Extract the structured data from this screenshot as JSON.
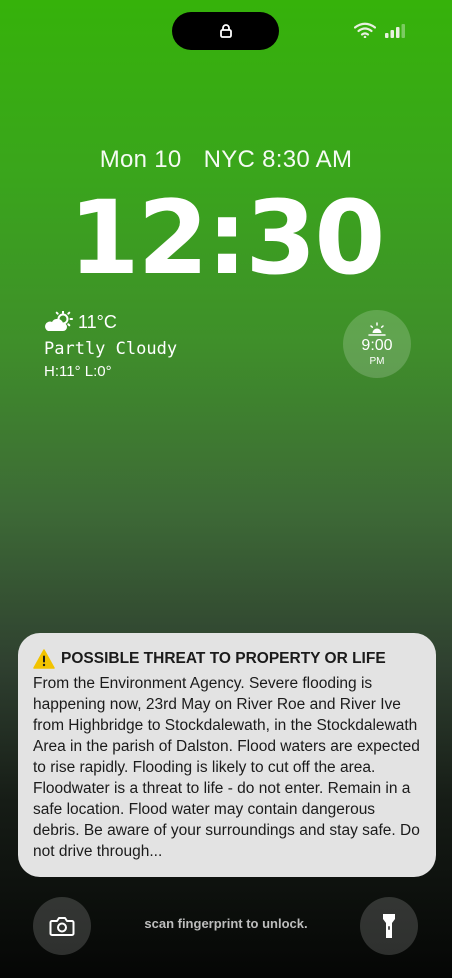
{
  "lock_screen": {
    "date": "Mon 10",
    "world_clock": "NYC 8:30 AM",
    "time": "12:30",
    "weather": {
      "temperature": "11°C",
      "condition": "Partly Cloudy",
      "range": "H:11° L:0°",
      "icon": "partly-cloudy-icon"
    },
    "sunset_widget": {
      "time": "9:00",
      "ampm": "PM",
      "icon": "sunset-icon"
    }
  },
  "notification": {
    "icon": "warning-icon",
    "title": "POSSIBLE THREAT TO PROPERTY OR LIFE",
    "body": "From the Environment Agency. Severe flooding is happening now, 23rd May on River Roe and River Ive from Highbridge to Stockdalewath, in the Stockdalewath Area in the parish of Dalston. Flood waters are expected to rise rapidly. Flooding is likely to cut off the area. Floodwater is a threat to life - do not enter. Remain in a safe location. Flood water may contain dangerous debris. Be aware of your surroundings and stay safe. Do not drive through..."
  },
  "bottom": {
    "unlock_hint": "scan fingerprint to unlock.",
    "camera_icon": "camera-icon",
    "flashlight_icon": "flashlight-icon"
  },
  "colors": {
    "gradient_top": "#36b20a",
    "gradient_bottom": "#050605",
    "notification_bg": "#e3e3e3",
    "warning": "#f2c300"
  }
}
